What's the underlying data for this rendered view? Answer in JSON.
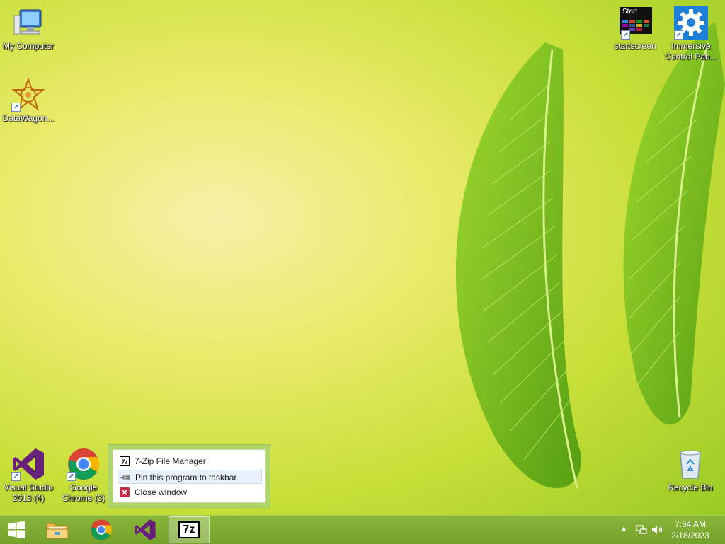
{
  "desktop": {
    "icons": {
      "my_computer": "My Computer",
      "datawagon": "DataWagon...",
      "startscreen": "startscreen",
      "startscreen_tile": "Start",
      "immersive_line1": "Immersive",
      "immersive_line2": "Control Pan...",
      "visual_studio_line1": "Visual Studio",
      "visual_studio_line2": "2013 (4)",
      "chrome_line1": "Google",
      "chrome_line2": "Chrome (3)",
      "recycle_bin": "Recycle Bin"
    }
  },
  "jump_list": {
    "items": [
      {
        "label": "7-Zip File Manager",
        "icon": "7zip-icon"
      },
      {
        "label": "Pin this program to taskbar",
        "icon": "pin-icon"
      },
      {
        "label": "Close window",
        "icon": "close-icon"
      }
    ]
  },
  "taskbar": {
    "icon_7z": "7z",
    "clock": {
      "time": "7:54 AM",
      "date": "2/18/2023"
    }
  },
  "colors": {
    "taskbar": "#7dab30",
    "vs_purple": "#68217a",
    "close_red": "#c4314b"
  }
}
